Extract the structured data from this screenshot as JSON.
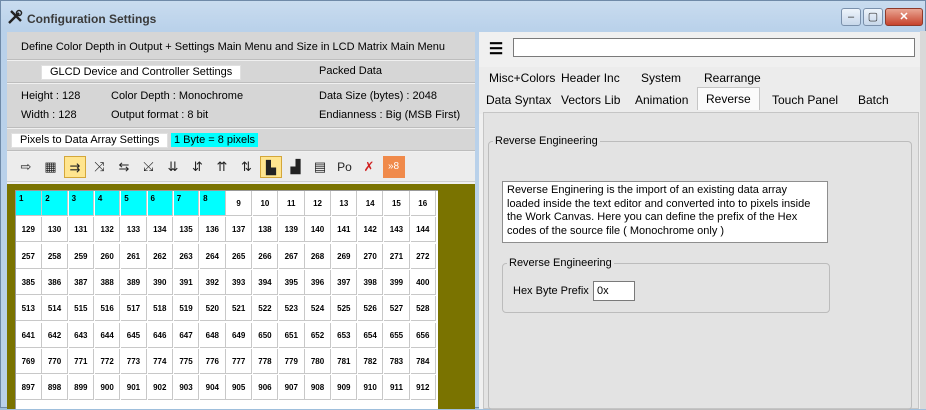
{
  "window": {
    "title": "Configuration Settings",
    "min_label": "–",
    "max_label": "▢",
    "close_label": "✕"
  },
  "left": {
    "info_line": "Define Color Depth in Output + Settings Main Menu and Size in LCD Matrix Main Menu",
    "device_label": "GLCD Device and Controller Settings",
    "packed_label": "Packed Data",
    "height": "Height : 128",
    "color_depth": "Color Depth :  Monochrome",
    "data_size": "Data Size (bytes) :  2048",
    "width": "Width : 128",
    "output_format": "Output format :  8 bit",
    "endianness": "Endianness :  Big (MSB First)",
    "pixels_label": "Pixels to Data Array Settings",
    "byte_label": "1 Byte = 8 pixels"
  },
  "toolbar": [
    {
      "name": "arrow-right-icon",
      "glyph": "⇨"
    },
    {
      "name": "grid-icon",
      "glyph": "▦"
    },
    {
      "name": "horizontal-scan-icon",
      "glyph": "⇉"
    },
    {
      "name": "shuffle-horizontal-icon",
      "glyph": "⤨"
    },
    {
      "name": "swap-horizontal-icon",
      "glyph": "⇆"
    },
    {
      "name": "shuffle-vertical-icon",
      "glyph": "⤩"
    },
    {
      "name": "vertical-down-icon",
      "glyph": "⇊"
    },
    {
      "name": "vertical-swap-icon",
      "glyph": "⇵"
    },
    {
      "name": "vertical-up-icon",
      "glyph": "⇈"
    },
    {
      "name": "vertical-mixed-icon",
      "glyph": "⇅"
    },
    {
      "name": "bar-low-icon",
      "glyph": "▙"
    },
    {
      "name": "bar-high-icon",
      "glyph": "▟"
    },
    {
      "name": "disabled-icon",
      "glyph": "▤"
    },
    {
      "name": "po-label-icon",
      "glyph": "Po"
    },
    {
      "name": "cross-icon",
      "glyph": "✗"
    },
    {
      "name": "shift-8-icon",
      "glyph": "»8"
    }
  ],
  "grid": {
    "rows": [
      [
        1,
        2,
        3,
        4,
        5,
        6,
        7,
        8,
        9,
        10,
        11,
        12,
        13,
        14,
        15,
        16
      ],
      [
        129,
        130,
        131,
        132,
        133,
        134,
        135,
        136,
        137,
        138,
        139,
        140,
        141,
        142,
        143,
        144
      ],
      [
        257,
        258,
        259,
        260,
        261,
        262,
        263,
        264,
        265,
        266,
        267,
        268,
        269,
        270,
        271,
        272
      ],
      [
        385,
        386,
        387,
        388,
        389,
        390,
        391,
        392,
        393,
        394,
        395,
        396,
        397,
        398,
        399,
        400
      ],
      [
        513,
        514,
        515,
        516,
        517,
        518,
        519,
        520,
        521,
        522,
        523,
        524,
        525,
        526,
        527,
        528
      ],
      [
        641,
        642,
        643,
        644,
        645,
        646,
        647,
        648,
        649,
        650,
        651,
        652,
        653,
        654,
        655,
        656
      ],
      [
        769,
        770,
        771,
        772,
        773,
        774,
        775,
        776,
        777,
        778,
        779,
        780,
        781,
        782,
        783,
        784
      ],
      [
        897,
        898,
        899,
        900,
        901,
        902,
        903,
        904,
        905,
        906,
        907,
        908,
        909,
        910,
        911,
        912
      ]
    ],
    "highlighted_count": 8
  },
  "right": {
    "menu_glyph": "☰",
    "search_value": "",
    "tabs_row1": [
      "Misc+Colors",
      "Header Inc",
      "System",
      "Rearrange"
    ],
    "tabs_row2": [
      "Data Syntax",
      "Vectors Lib",
      "Animation",
      "Reverse",
      "Touch Panel",
      "Batch"
    ],
    "active_tab": "Reverse",
    "group_title": "Reverse Engineering",
    "description": "Reverse Enginering is the import of an existing data array loaded inside the text editor and converted into to pixels inside the Work Canvas. Here you can define the prefix of the Hex codes of the source file ( Monochrome only )",
    "inner_group_title": "Reverse Engineering",
    "hex_label": "Hex Byte Prefix",
    "hex_value": "0x"
  }
}
